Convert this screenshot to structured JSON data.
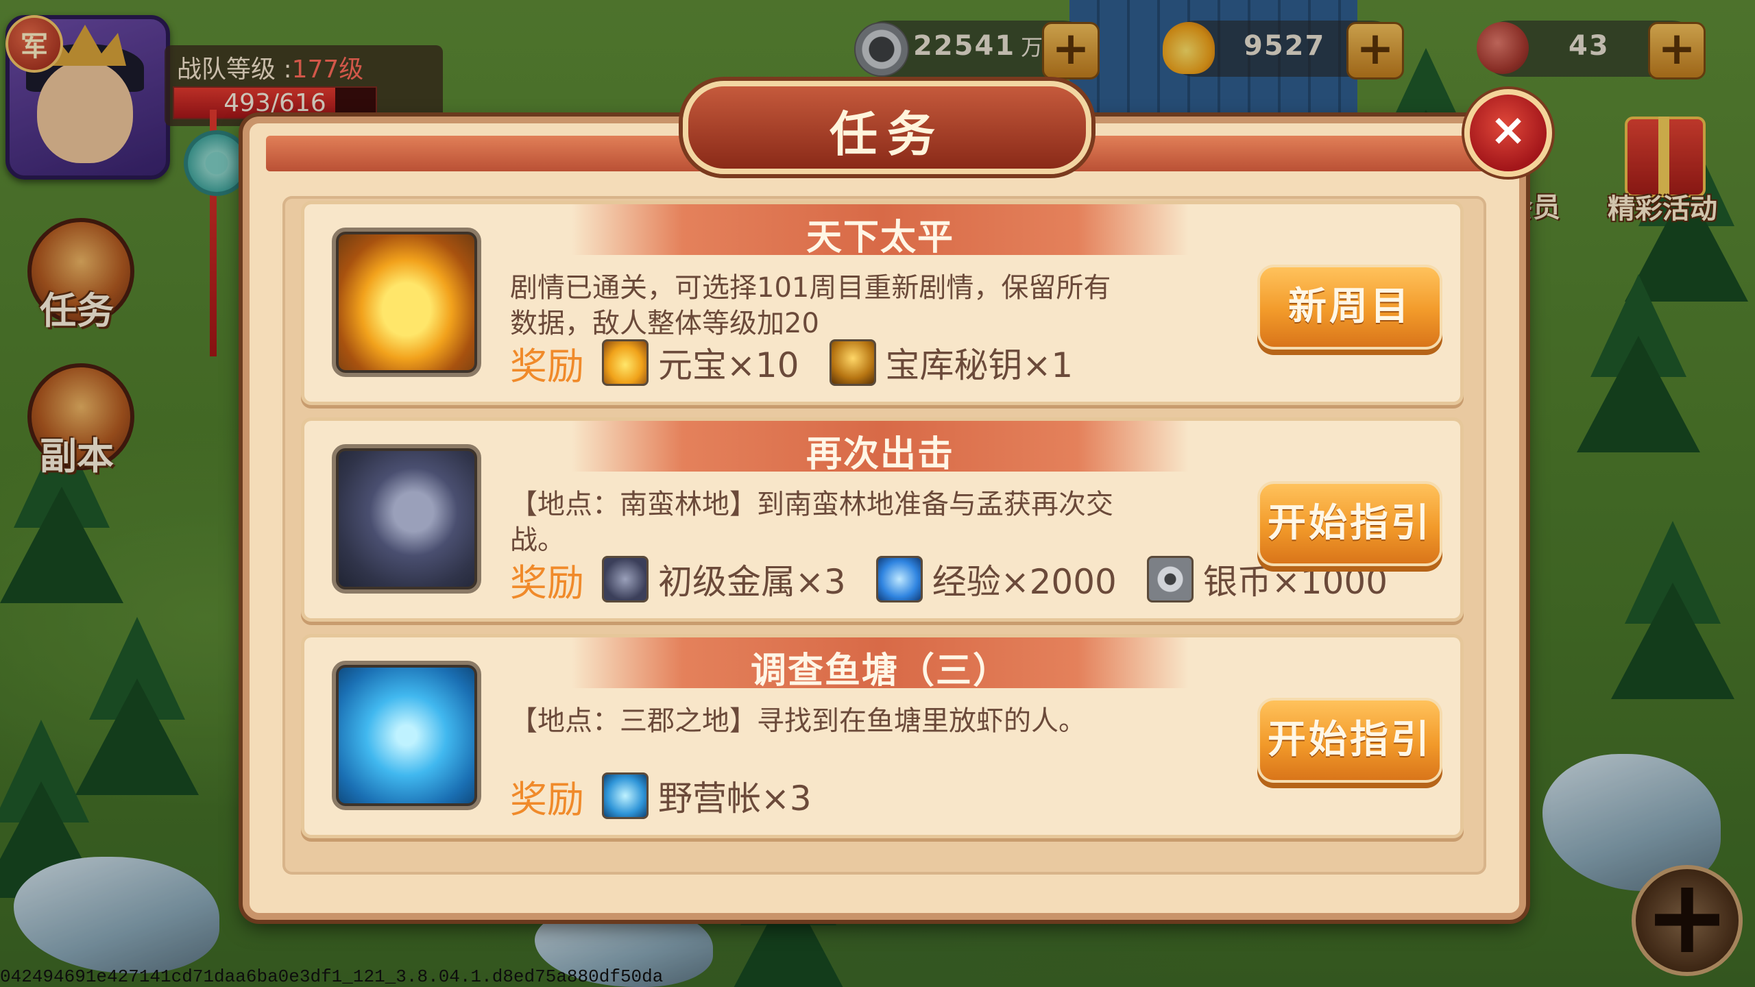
{
  "hud": {
    "rank_badge": "军",
    "team_level_label": "战队等级 :",
    "team_level_value": "177级",
    "xp_text": "493/616",
    "xp_progress": 0.8,
    "silver": "22541",
    "silver_unit": "万",
    "gold": "9527",
    "stamina": "43",
    "plus_symbol": "+"
  },
  "side_menu": [
    {
      "label": "任务"
    },
    {
      "label": "副本"
    }
  ],
  "right_menu": {
    "member_label": "会员",
    "events_label": "精彩活动"
  },
  "modal": {
    "title": "任务",
    "close_symbol": "×",
    "reward_label": "奖励",
    "tasks": [
      {
        "name": "天下太平",
        "icon": "gold-ingot-icon",
        "desc": "剧情已通关，可选择101周目重新剧情，保留所有数据，敌人整体等级加20",
        "rewards": [
          {
            "icon": "gold-ingot-icon",
            "text": "元宝×10"
          },
          {
            "icon": "treasure-key-icon",
            "text": "宝库秘钥×1"
          }
        ],
        "button": "新周目"
      },
      {
        "name": "再次出击",
        "icon": "metal-ore-icon",
        "desc": "【地点：南蛮林地】到南蛮林地准备与孟获再次交战。",
        "rewards": [
          {
            "icon": "metal-ore-icon",
            "text": "初级金属×3"
          },
          {
            "icon": "experience-crystal-icon",
            "text": "经验×2000"
          },
          {
            "icon": "silver-coin-icon",
            "text": "银币×1000"
          }
        ],
        "button": "开始指引"
      },
      {
        "name": "调查鱼塘（三）",
        "icon": "camp-tent-icon",
        "desc": "【地点：三郡之地】寻找到在鱼塘里放虾的人。",
        "rewards": [
          {
            "icon": "camp-tent-icon",
            "text": "野营帐×3"
          }
        ],
        "button": "开始指引"
      }
    ]
  },
  "corner_plus": "+",
  "debug_text": "042494691e427141cd71daa6ba0e3df1_121_3.8.04.1.d8ed75a880df50da",
  "colors": {
    "accent_orange": "#f08a2a",
    "panel_bg": "#f4dcb8",
    "title_red": "#8a2a18"
  }
}
